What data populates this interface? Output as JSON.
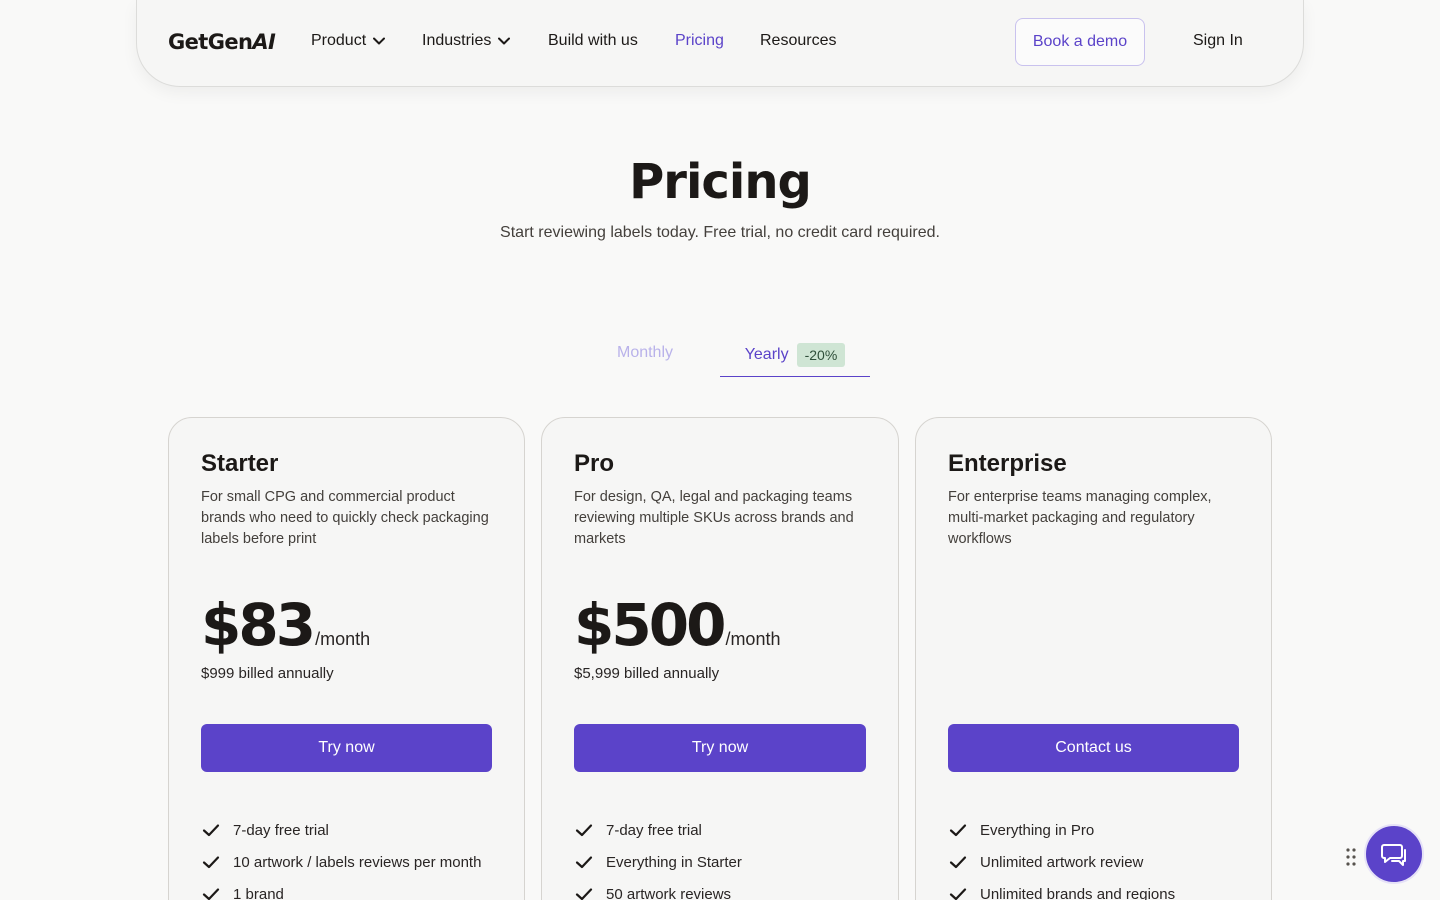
{
  "nav": {
    "logo_main": "GetGen",
    "logo_ai": "AI",
    "links": [
      {
        "label": "Product",
        "dropdown": true
      },
      {
        "label": "Industries",
        "dropdown": true
      },
      {
        "label": "Build with us",
        "dropdown": false
      },
      {
        "label": "Pricing",
        "dropdown": false,
        "active": true
      },
      {
        "label": "Resources",
        "dropdown": false
      }
    ],
    "demo_label": "Book a demo",
    "signin_label": "Sign In"
  },
  "hero": {
    "title": "Pricing",
    "subtitle": "Start reviewing labels today. Free trial, no credit card required."
  },
  "toggle": {
    "monthly_label": "Monthly",
    "yearly_label": "Yearly",
    "yearly_badge": "-20%",
    "selected": "Yearly"
  },
  "plans": [
    {
      "name": "Starter",
      "description": "For small CPG and commercial product brands who need to quickly check packaging labels before print",
      "price": "$83",
      "period": "/month",
      "billed": "$999 billed annually",
      "cta": "Try now",
      "features": [
        "7-day free trial",
        "10 artwork / labels reviews per month",
        "1 brand"
      ]
    },
    {
      "name": "Pro",
      "description": "For design, QA, legal and packaging teams reviewing multiple SKUs across brands and markets",
      "price": "$500",
      "period": "/month",
      "billed": "$5,999 billed annually",
      "cta": "Try now",
      "features": [
        "7-day free trial",
        "Everything in Starter",
        "50 artwork reviews"
      ]
    },
    {
      "name": "Enterprise",
      "description": "For enterprise teams managing complex, multi-market packaging and regulatory workflows",
      "price": "",
      "period": "",
      "billed": "",
      "cta": "Contact us",
      "features": [
        "Everything in Pro",
        "Unlimited artwork review",
        "Unlimited brands and regions"
      ]
    }
  ],
  "icons": {
    "chevron": "chevron-down-icon",
    "check": "check-icon",
    "chat": "chat-icon",
    "drag": "drag-handle-icon"
  },
  "colors": {
    "accent": "#5b43c9",
    "background": "#f9f9f8",
    "badge_bg": "#cfe5d4"
  }
}
